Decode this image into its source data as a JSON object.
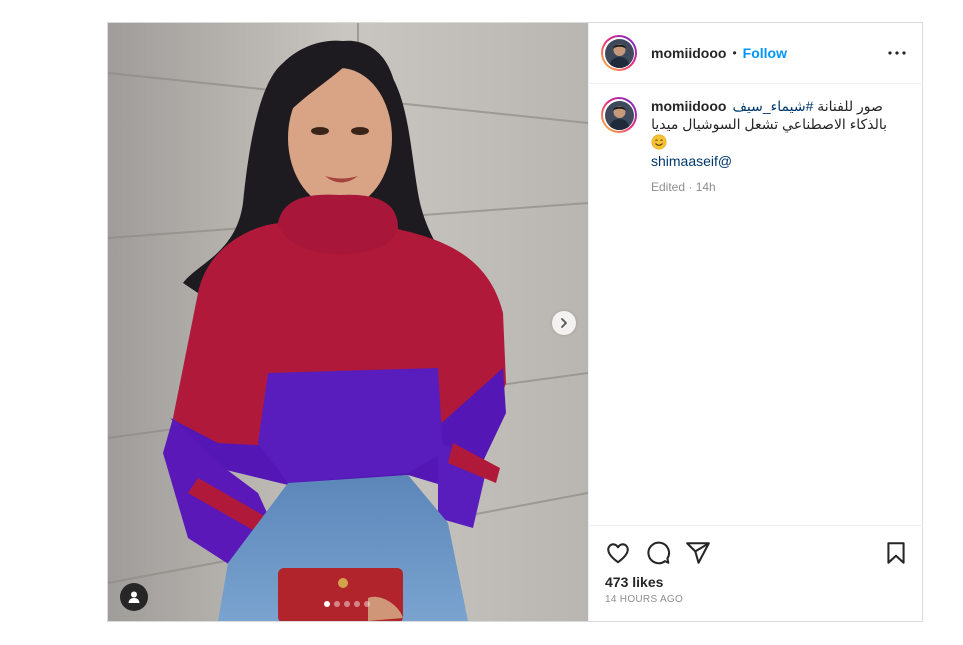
{
  "post": {
    "username": "momiidooo",
    "follow_label": "Follow",
    "separator": "•",
    "caption": {
      "arabic_line1_start": "صور للفنانة ",
      "hashtag": "#شيماء_سيف",
      "arabic_line2": "بالذكاء الاصطناعي تشعل السوشيال ميديا",
      "emoji": "smiling-face-emoji",
      "mention": "shimaaseif@"
    },
    "edited_meta": "Edited · 14h",
    "likes": "473 likes",
    "timestamp": "14 HOURS AGO",
    "carousel": {
      "total_slides": 5,
      "current_slide": 1
    }
  },
  "icons": {
    "like": "heart-icon",
    "comment": "comment-icon",
    "share": "paper-plane-icon",
    "save": "bookmark-icon",
    "more": "more-options-icon",
    "tag": "user-tag-icon",
    "next": "chevron-right-icon"
  },
  "colors": {
    "accent_blue": "#0095f6",
    "link_blue": "#00376b",
    "muted_text": "#8e8e8e",
    "border": "#dbdbdb"
  }
}
